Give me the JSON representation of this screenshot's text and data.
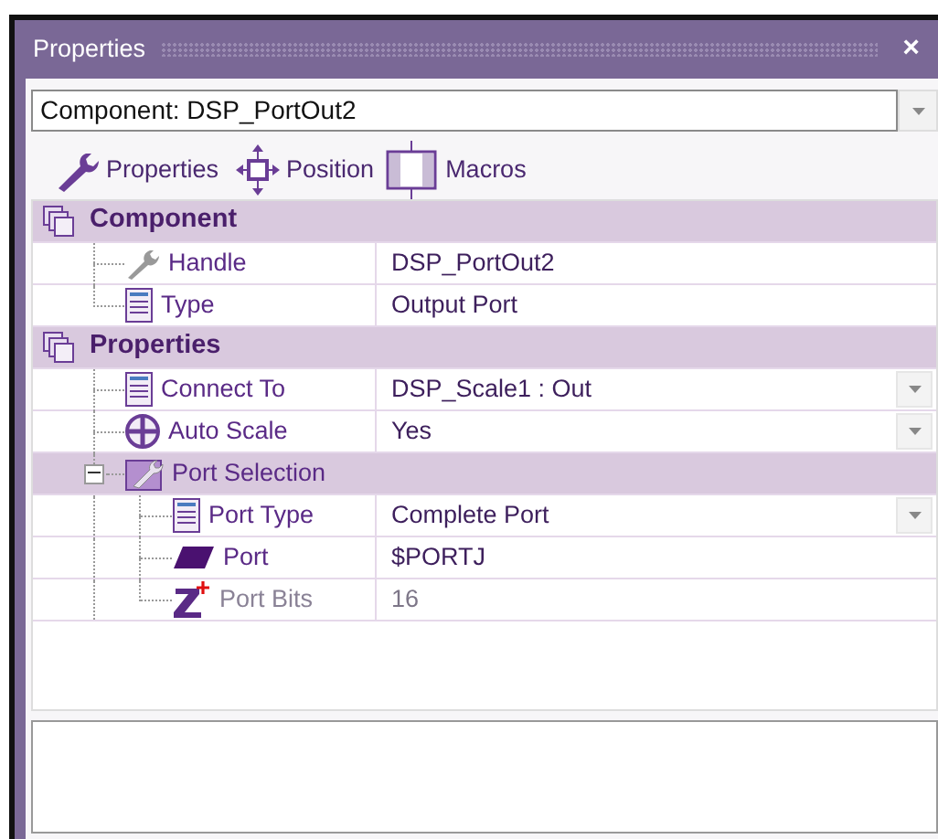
{
  "window": {
    "title": "Properties",
    "close": "×"
  },
  "selector": {
    "value": "Component: DSP_PortOut2"
  },
  "toolbar": [
    {
      "label": "Properties"
    },
    {
      "label": "Position"
    },
    {
      "label": "Macros"
    }
  ],
  "grid": [
    {
      "kind": "category",
      "name": "Component",
      "children": [
        {
          "kind": "property",
          "name": "Handle",
          "value": "DSP_PortOut2",
          "dropdown": false,
          "disabled": false
        },
        {
          "kind": "property",
          "name": "Type",
          "value": "Output Port",
          "dropdown": false,
          "disabled": false
        }
      ]
    },
    {
      "kind": "category",
      "name": "Properties",
      "children": [
        {
          "kind": "property",
          "name": "Connect To",
          "value": "DSP_Scale1 : Out",
          "dropdown": true,
          "disabled": false
        },
        {
          "kind": "property",
          "name": "Auto Scale",
          "value": "Yes",
          "dropdown": true,
          "disabled": false
        },
        {
          "kind": "group",
          "name": "Port Selection",
          "expanded": true,
          "children": [
            {
              "kind": "property",
              "name": "Port Type",
              "value": "Complete Port",
              "dropdown": true,
              "disabled": false
            },
            {
              "kind": "property",
              "name": "Port",
              "value": "$PORTJ",
              "dropdown": false,
              "disabled": false
            },
            {
              "kind": "property",
              "name": "Port Bits",
              "value": "16",
              "dropdown": false,
              "disabled": true
            }
          ]
        }
      ]
    }
  ]
}
